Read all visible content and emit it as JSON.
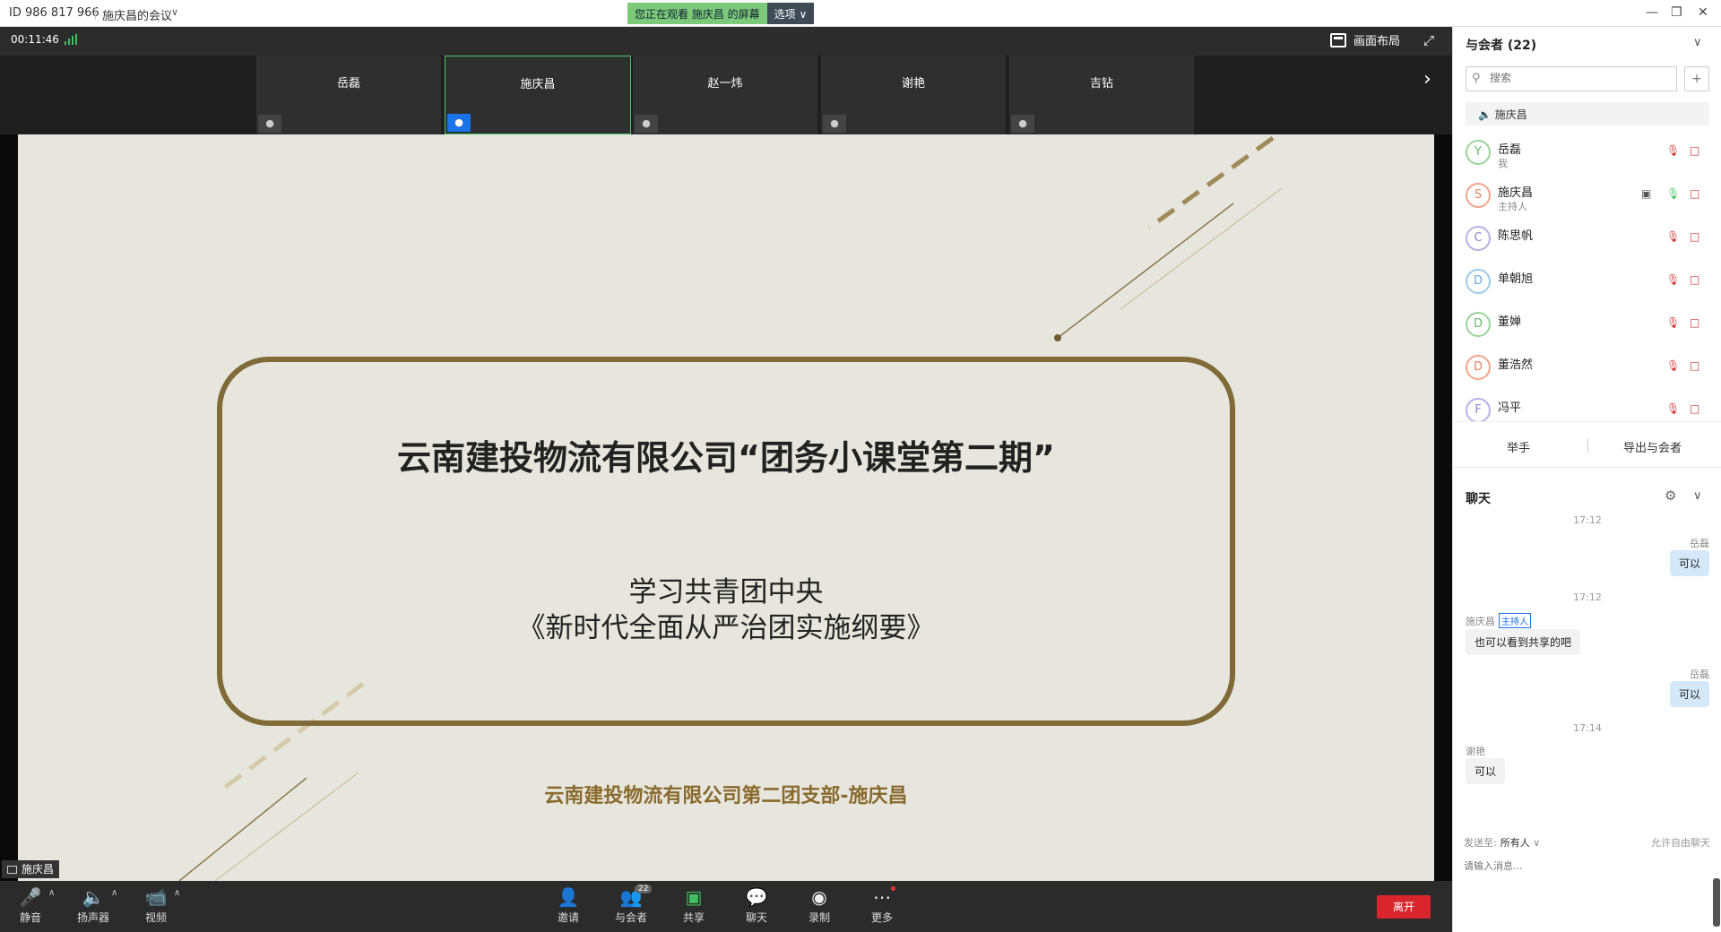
{
  "titlebar": {
    "meeting_id": "ID 986 817 966",
    "meeting_name": "施庆昌的会议",
    "viewing_msg": "您正在观看 施庆昌 的屏幕",
    "options_label": "选项"
  },
  "topbar": {
    "timer": "00:11:46",
    "layout_label": "画面布局"
  },
  "video_strip": [
    {
      "name": "岳磊"
    },
    {
      "name": "施庆昌"
    },
    {
      "name": "赵一炜"
    },
    {
      "name": "谢艳"
    },
    {
      "name": "吉钻"
    }
  ],
  "slide": {
    "title": "云南建投物流有限公司“团务小课堂第二期”",
    "subtitle1": "学习共青团中央",
    "subtitle2": "《新时代全面从严治团实施纲要》",
    "footer": "云南建投物流有限公司第二团支部-施庆昌"
  },
  "speaker_tag": "施庆昌",
  "toolbar": {
    "mute": "静音",
    "speaker": "扬声器",
    "video": "视频",
    "invite": "邀请",
    "participants": "与会者",
    "participants_badge": "22",
    "share": "共享",
    "chat": "聊天",
    "record": "录制",
    "more": "更多",
    "leave": "离开"
  },
  "panel": {
    "title": "与会者 (22)",
    "search_placeholder": "搜索",
    "speaking": "施庆昌",
    "participants": [
      {
        "initial": "Y",
        "name": "岳磊",
        "role": "我"
      },
      {
        "initial": "S",
        "name": "施庆昌",
        "role": "主持人"
      },
      {
        "initial": "C",
        "name": "陈思帆",
        "role": ""
      },
      {
        "initial": "D",
        "name": "单朝旭",
        "role": ""
      },
      {
        "initial": "D",
        "name": "董婵",
        "role": ""
      },
      {
        "initial": "D",
        "name": "董浩然",
        "role": ""
      },
      {
        "initial": "F",
        "name": "冯平",
        "role": ""
      }
    ],
    "raise_hand": "举手",
    "export": "导出与会者"
  },
  "chat": {
    "title": "聊天",
    "messages": [
      {
        "time": "17:12",
        "sender": "岳磊",
        "text": "可以"
      },
      {
        "time": "17:12",
        "sender": "施庆昌",
        "tag": "主持人",
        "text": "也可以看到共享的吧"
      },
      {
        "sender": "岳磊",
        "text": "可以"
      },
      {
        "time": "17:14",
        "sender": "谢艳",
        "text": "可以"
      }
    ],
    "send_to_label": "发送至:",
    "send_to_value": "所有人",
    "free_chat": "允许自由聊天",
    "input_placeholder": "请输入消息..."
  },
  "colors": {
    "accent_green": "#45c56b",
    "leave_red": "#d9262d",
    "slide_gold": "#806a38"
  }
}
